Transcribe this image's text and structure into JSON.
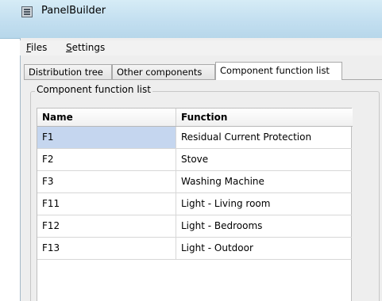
{
  "window": {
    "title": "PanelBuilder"
  },
  "menu": {
    "files": "Files",
    "settings": "Settings"
  },
  "tabs": [
    {
      "label": "Distribution tree"
    },
    {
      "label": "Other components"
    },
    {
      "label": "Component function list",
      "active": true
    }
  ],
  "panel": {
    "group_title": "Component function list"
  },
  "table": {
    "columns": [
      "Name",
      "Function"
    ],
    "rows": [
      {
        "name": "F1",
        "function": "Residual Current Protection",
        "selected": true
      },
      {
        "name": "F2",
        "function": "Stove"
      },
      {
        "name": "F3",
        "function": "Washing Machine"
      },
      {
        "name": "F11",
        "function": "Light - Living room"
      },
      {
        "name": "F12",
        "function": "Light - Bedrooms"
      },
      {
        "name": "F13",
        "function": "Light - Outdoor"
      }
    ]
  },
  "colors": {
    "selection": "#c5d6ef",
    "titlebar": "#c3dff0"
  }
}
